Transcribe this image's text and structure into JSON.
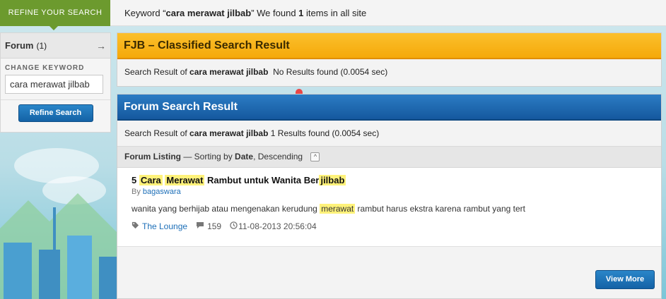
{
  "topbar": {
    "refine_tab_label": "REFINE YOUR SEARCH",
    "keyword_prefix": "Keyword “",
    "keyword": "cara merawat jilbab",
    "keyword_suffix": "” We found ",
    "found_count": "1",
    "found_suffix": " items in all site"
  },
  "sidebar": {
    "forum_label": "Forum",
    "forum_count": "(1)",
    "change_keyword_label": "CHANGE KEYWORD",
    "keyword_value": "cara merawat jilbab",
    "refine_button": "Refine Search"
  },
  "fjb_panel": {
    "title": "FJB – Classified Search Result",
    "result_prefix": "Search Result of ",
    "result_keyword": "cara merawat jilbab",
    "result_status": "No Results found (0.0054 sec)"
  },
  "forum_panel": {
    "title": "Forum Search Result",
    "result_prefix": "Search Result of ",
    "result_keyword": "cara merawat jilbab",
    "result_status": "1 Results found (0.0054 sec)",
    "listing_label": "Forum Listing",
    "sorting_prefix": "— Sorting by ",
    "sorting_field": "Date",
    "sorting_order": ", Descending",
    "collapse_symbol": "^",
    "items": [
      {
        "title_parts": [
          "5 ",
          "Cara",
          " ",
          "Merawat",
          " Rambut untuk Wanita Ber",
          "jilbab"
        ],
        "by_label": "By ",
        "author": "bagaswara",
        "snippet_before": "wanita yang berhijab atau mengenakan kerudung ",
        "snippet_highlight": "merawat",
        "snippet_after": " rambut harus ekstra karena rambut yang tert",
        "forum": "The Lounge",
        "replies": "159",
        "datetime": "11-08-2013 20:56:04"
      }
    ],
    "view_more_button": "View More"
  },
  "icons": {
    "arrow_right": "→",
    "tag": "tag-icon",
    "comment": "comment-icon",
    "clock": "clock-icon"
  },
  "colors": {
    "refine_tab": "#6c9a2e",
    "fjb_header": "#f5a90a",
    "forum_header": "#15589e",
    "highlight": "#fff27a",
    "link": "#1d6fb8"
  }
}
